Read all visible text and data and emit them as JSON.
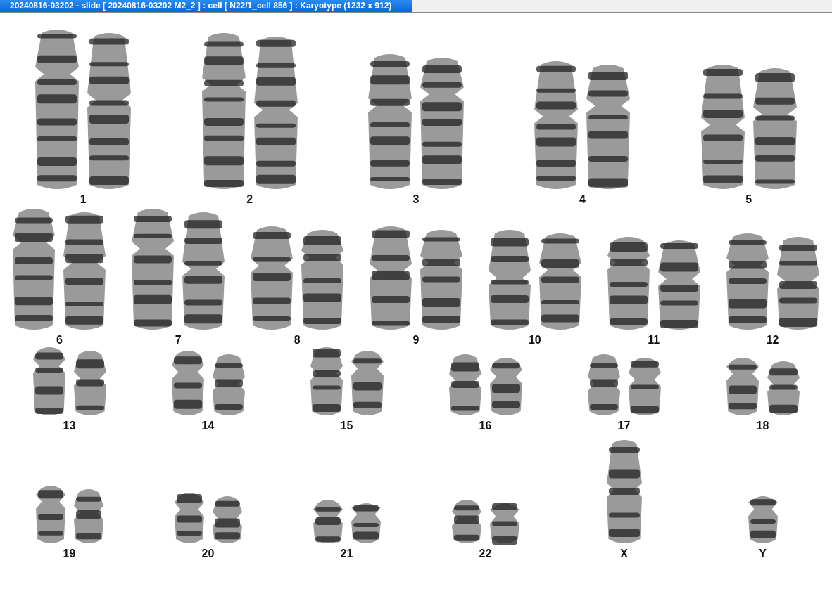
{
  "window": {
    "title": "20240816-03202 - slide [ 20240816-03202 M2_2 ] : cell [ N22/1_cell 856 ] : Karyotype  (1232 x 912)"
  },
  "karyotype": {
    "rows": [
      {
        "items": [
          {
            "label": "1",
            "kind": "pair"
          },
          {
            "label": "2",
            "kind": "pair"
          },
          {
            "label": "3",
            "kind": "pair"
          },
          {
            "label": "4",
            "kind": "pair"
          },
          {
            "label": "5",
            "kind": "pair"
          }
        ]
      },
      {
        "items": [
          {
            "label": "6",
            "kind": "pair"
          },
          {
            "label": "7",
            "kind": "pair"
          },
          {
            "label": "8",
            "kind": "pair"
          },
          {
            "label": "9",
            "kind": "pair"
          },
          {
            "label": "10",
            "kind": "pair"
          },
          {
            "label": "11",
            "kind": "pair"
          },
          {
            "label": "12",
            "kind": "pair"
          }
        ]
      },
      {
        "items": [
          {
            "label": "13",
            "kind": "pair"
          },
          {
            "label": "14",
            "kind": "pair"
          },
          {
            "label": "15",
            "kind": "pair"
          },
          {
            "label": "16",
            "kind": "pair"
          },
          {
            "label": "17",
            "kind": "pair"
          },
          {
            "label": "18",
            "kind": "pair"
          }
        ]
      },
      {
        "items": [
          {
            "label": "19",
            "kind": "pair"
          },
          {
            "label": "20",
            "kind": "pair"
          },
          {
            "label": "21",
            "kind": "pair"
          },
          {
            "label": "22",
            "kind": "pair"
          },
          {
            "label": "X",
            "kind": "single-long"
          },
          {
            "label": "Y",
            "kind": "single-short"
          }
        ]
      }
    ]
  }
}
